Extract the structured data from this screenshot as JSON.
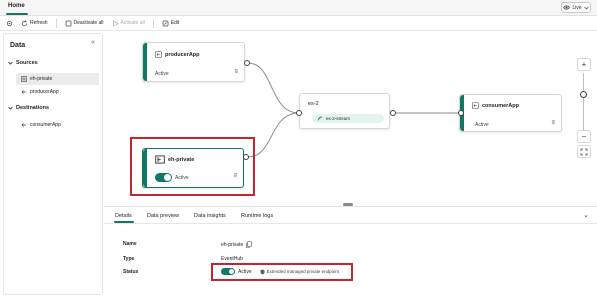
{
  "header": {
    "tab": "Home",
    "live_label": "Live"
  },
  "toolbar": {
    "refresh": "Refresh",
    "deactivate_all": "Deactivate all",
    "activate_all": "Activate all",
    "edit": "Edit"
  },
  "sidebar": {
    "title": "Data",
    "sources_label": "Sources",
    "sources": [
      {
        "label": "eh-private",
        "selected": true
      },
      {
        "label": "producerApp",
        "selected": false
      }
    ],
    "destinations_label": "Destinations",
    "destinations": [
      {
        "label": "consumerApp"
      }
    ]
  },
  "canvas": {
    "producer": {
      "title": "producerApp",
      "status": "Active"
    },
    "eventhub": {
      "title": "eh-private",
      "status": "Active"
    },
    "stream": {
      "title": "es-2",
      "chip": "es-2-stream"
    },
    "consumer": {
      "title": "consumerApp",
      "status": "Active"
    },
    "zoom_in": "+",
    "zoom_out": "−"
  },
  "details": {
    "tabs": [
      "Details",
      "Data preview",
      "Data insights",
      "Runtime logs"
    ],
    "active_tab": "Details",
    "name_label": "Name",
    "name_value": "eh-private",
    "type_label": "Type",
    "type_value": "EventHub",
    "status_label": "Status",
    "status_value": "Active",
    "connection_note": "Extended managed private endpoint"
  },
  "colors": {
    "accent": "#117865",
    "highlight": "#c4262e"
  }
}
